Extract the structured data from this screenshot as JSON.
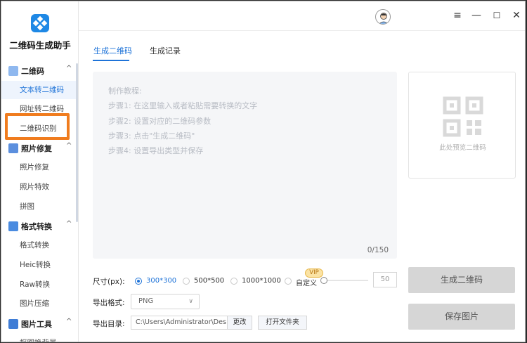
{
  "app": {
    "title": "二维码生成助手"
  },
  "sidebar": {
    "sections": [
      {
        "label": "二维码",
        "items": [
          "文本转二维码",
          "网址转二维码",
          "二维码识别"
        ]
      },
      {
        "label": "照片修复",
        "items": [
          "照片修复",
          "照片特效",
          "拼图"
        ]
      },
      {
        "label": "格式转换",
        "items": [
          "格式转换",
          "Heic转换",
          "Raw转换",
          "图片压缩"
        ]
      },
      {
        "label": "图片工具",
        "items": [
          "抠图换背景"
        ]
      }
    ],
    "active_item": "文本转二维码",
    "highlighted_item": "二维码识别"
  },
  "titlebar": {
    "menu_icon": "≡",
    "minimize_icon": "—",
    "maximize_icon": "☐",
    "close_icon": "✕"
  },
  "tabs": [
    {
      "label": "生成二维码",
      "active": true
    },
    {
      "label": "生成记录",
      "active": false
    }
  ],
  "editor": {
    "lines": [
      "制作教程:",
      "步骤1: 在这里输入或者粘贴需要转换的文字",
      "步骤2: 设置对应的二维码参数",
      "步骤3: 点击\"生成二维码\"",
      "步骤4: 设置导出类型并保存"
    ],
    "counter": "0/150"
  },
  "preview": {
    "placeholder": "此处预览二维码"
  },
  "settings": {
    "size_label": "尺寸(px):",
    "size_options": [
      "300*300",
      "500*500",
      "1000*1000",
      "自定义"
    ],
    "size_selected": "300*300",
    "vip_badge": "VIP",
    "custom_value": "50",
    "format_label": "导出格式:",
    "format_value": "PNG",
    "dir_label": "导出目录:",
    "dir_value": "C:\\Users\\Administrator\\Des",
    "change_button": "更改",
    "open_folder_button": "打开文件夹"
  },
  "actions": {
    "generate": "生成二维码",
    "save": "保存图片"
  },
  "colors": {
    "accent": "#1e73d8",
    "highlight_border": "#f07c1e",
    "logo": "#1e88e5"
  }
}
